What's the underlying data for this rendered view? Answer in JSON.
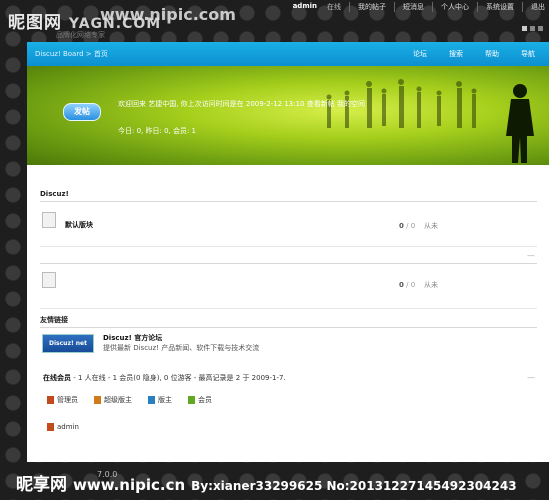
{
  "header": {
    "logo_text": "昵图网",
    "logo_overlay": "YAGN.COM",
    "watermark_top": "www.nipic.com",
    "subtitle": "品牌化网络专家",
    "user": "admin",
    "status": "在线",
    "menu": [
      "我的帖子",
      "短消息",
      "个人中心",
      "系统设置",
      "退出"
    ]
  },
  "nav": {
    "breadcrumb": "Discuz! Board > 首页",
    "links": [
      "论坛",
      "搜索",
      "帮助",
      "导航"
    ]
  },
  "banner": {
    "post_button": "发帖",
    "welcome": "欢迎回来  艺捷中国, 你上次访问时间是在  2009-2-12 13:10  查看新帖  我的空间",
    "stats": "今日: 0, 昨日: 0, 会员: 1"
  },
  "section1": {
    "title": "Discuz!",
    "forum_name": "默认版块",
    "threads": "0",
    "posts": "0",
    "last_post": "从未"
  },
  "section2": {
    "threads": "0",
    "posts": "0",
    "last_post": "从未"
  },
  "links": {
    "title": "友情链接",
    "logo": "Discuz! net",
    "site_title": "Discuz! 官方论坛",
    "desc": "提供最新 Discuz! 产品新闻、软件下载与技术交流"
  },
  "online": {
    "label": "在线会员",
    "summary": " - 1 人在线 - 1 会员(0 隐身), 0 位游客 - 最高记录是 2 于 2009-1-7.",
    "legend": [
      {
        "label": "管理员",
        "color": "#c34a1a"
      },
      {
        "label": "超级版主",
        "color": "#d07a1a"
      },
      {
        "label": "版主",
        "color": "#2a7fc0"
      },
      {
        "label": "会员",
        "color": "#5fa81f"
      }
    ],
    "members": [
      "admin"
    ]
  },
  "footer": {
    "version": "7.0.0",
    "watermark": "昵享网",
    "url": "www.nipic.cn",
    "by": "By:xianer33299625  No:20131227145492304243"
  }
}
